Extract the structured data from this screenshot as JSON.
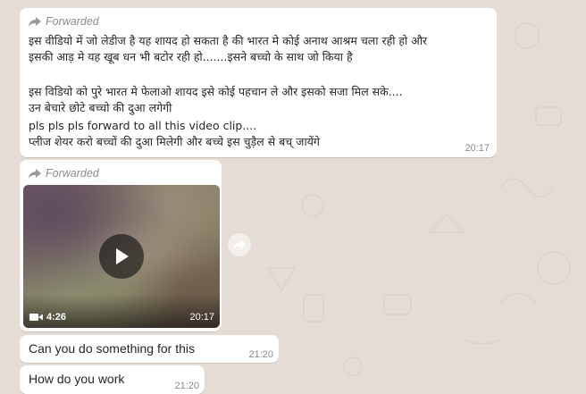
{
  "colors": {
    "chat_background": "#e5ddd5",
    "bubble": "#ffffff",
    "forwarded_label": "#8c8c8c",
    "timestamp": "#8a8a8a"
  },
  "messages": [
    {
      "forwarded_label": "Forwarded",
      "lines": [
        "इस वीडियो में जो लेडीज है यह शायद हो सकता है की भारत मे कोई अनाथ आश्रम चला रही हो और",
        "इसकी आड़ मे यह खूब धन भी बटोर रही हो.......इसने बच्चो के साथ जो किया है",
        "",
        "इस विडियो को पुरे भारत मे फेलाओ शायद इसे कोई पहचान ले और इसको सजा मिल सके....",
        "उन बेचारे छोटे बच्चो की दुआ लगेगी",
        "pls pls pls forward to all this video clip....",
        "प्लीज शेयर करो बच्चों की दुआ मिलेगी और बच्चे इस चुड़ैल से बच् जायेंगे"
      ],
      "time": "20:17"
    },
    {
      "forwarded_label": "Forwarded",
      "video": {
        "duration": "4:26",
        "time": "20:17",
        "camera_icon": "video-camera-icon",
        "play_icon": "play-icon"
      },
      "forward_button_icon": "share-forward-icon"
    },
    {
      "text": "Can you do something for this",
      "time": "21:20"
    },
    {
      "text": "How do you work",
      "time": "21:20"
    }
  ]
}
